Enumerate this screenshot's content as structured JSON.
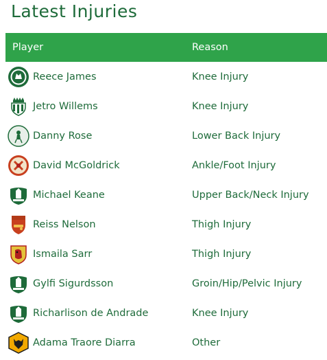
{
  "title": "Latest Injuries",
  "headers": {
    "player": "Player",
    "reason": "Reason"
  },
  "colors": {
    "accent": "#2fa34a",
    "text": "#1e6b3a"
  },
  "rows": [
    {
      "player": "Reece James",
      "reason": "Knee Injury",
      "crest": "chelsea-crest-icon"
    },
    {
      "player": "Jetro Willems",
      "reason": "Knee Injury",
      "crest": "newcastle-crest-icon"
    },
    {
      "player": "Danny Rose",
      "reason": "Lower Back Injury",
      "crest": "tottenham-crest-icon"
    },
    {
      "player": "David McGoldrick",
      "reason": "Ankle/Foot Injury",
      "crest": "sheffield-united-crest-icon"
    },
    {
      "player": "Michael Keane",
      "reason": "Upper Back/Neck Injury",
      "crest": "everton-crest-icon"
    },
    {
      "player": "Reiss Nelson",
      "reason": "Thigh Injury",
      "crest": "arsenal-crest-icon"
    },
    {
      "player": "Ismaila Sarr",
      "reason": "Thigh Injury",
      "crest": "watford-crest-icon"
    },
    {
      "player": "Gylfi Sigurdsson",
      "reason": "Groin/Hip/Pelvic Injury",
      "crest": "everton-crest-icon"
    },
    {
      "player": "Richarlison de Andrade",
      "reason": "Knee Injury",
      "crest": "everton-crest-icon"
    },
    {
      "player": "Adama Traore Diarra",
      "reason": "Other",
      "crest": "wolves-crest-icon"
    }
  ]
}
